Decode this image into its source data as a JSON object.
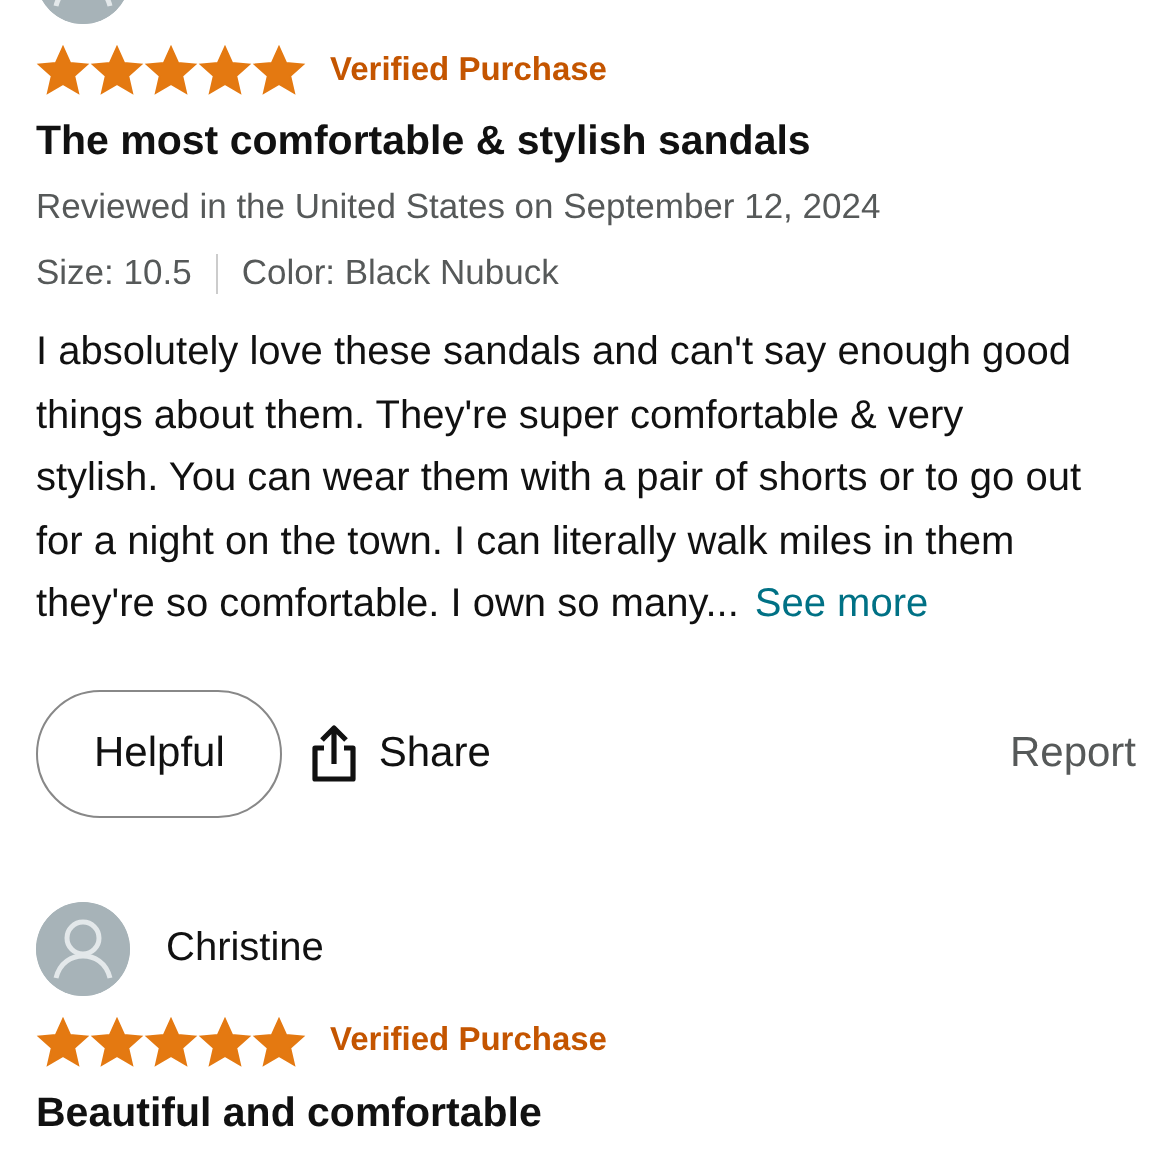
{
  "reviews": [
    {
      "stars": 5,
      "badge": "Verified Purchase",
      "title": "The most comfortable & stylish sandals",
      "date": "Reviewed in the United States on September 12, 2024",
      "size": "Size: 10.5",
      "style": "Color: Black Nubuck",
      "body": "I absolutely love these sandals and can't say enough good things about them. They're super comfortable & very stylish. You can wear them with a pair of shorts or to go out for a night on the town. I can literally walk miles in them they're so comfortable. I own so many...",
      "see_more": "See more",
      "actions": {
        "helpful": "Helpful",
        "share": "Share",
        "report": "Report"
      }
    },
    {
      "name": "Christine",
      "stars": 5,
      "badge": "Verified Purchase",
      "title": "Beautiful and comfortable"
    }
  ]
}
